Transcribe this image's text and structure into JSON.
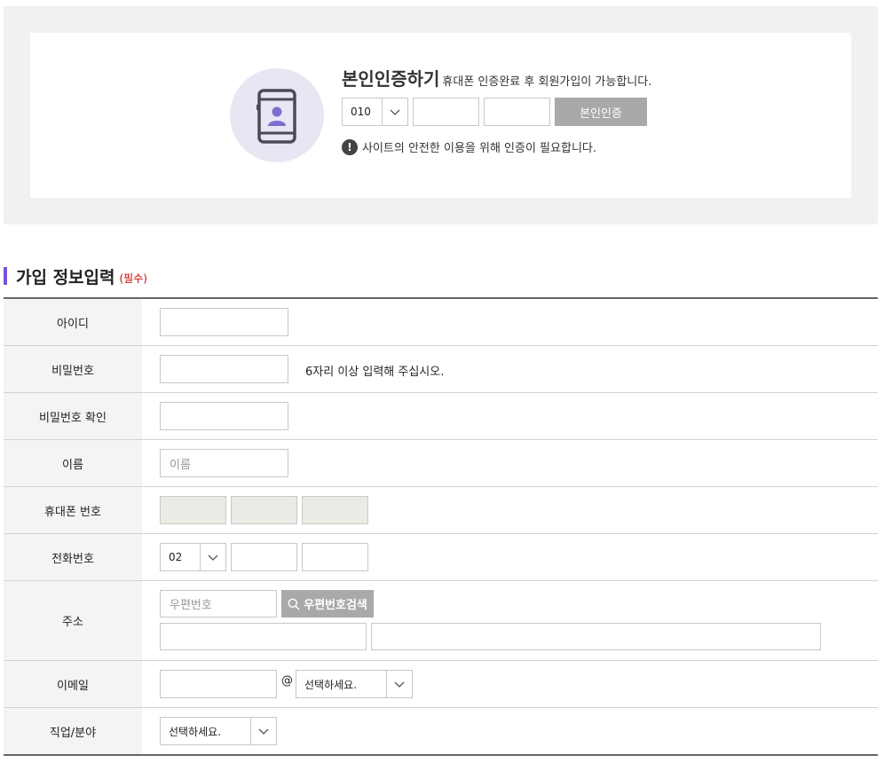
{
  "verify": {
    "title": "본인인증하기",
    "description": "휴대폰 인증완료 후 회원가입이 가능합니다.",
    "phone_prefix": "010",
    "button_label": "본인인증",
    "note": "사이트의 안전한 이용을 위해 인증이 필요합니다.",
    "note_icon": "!"
  },
  "section": {
    "title": "가입 정보입력",
    "required_tag": "(필수)"
  },
  "form": {
    "id_label": "아이디",
    "password_label": "비밀번호",
    "password_hint": "6자리 이상 입력해 주십시오.",
    "password_confirm_label": "비밀번호 확인",
    "name_label": "이름",
    "name_placeholder": "이름",
    "mobile_label": "휴대폰 번호",
    "phone_label": "전화번호",
    "phone_prefix": "02",
    "address_label": "주소",
    "zipcode_placeholder": "우편번호",
    "zipcode_button": "우편번호검색",
    "email_label": "이메일",
    "email_at": "@",
    "email_domain_select": "선택하세요.",
    "job_label": "직업/분야",
    "job_select": "선택하세요."
  },
  "colors": {
    "accent": "#7b52d9",
    "required": "#d10000",
    "button_gray": "#a9a9a9",
    "icon_circle": "#e9e6f3"
  },
  "icons": {
    "verify": "mobile-person-icon",
    "search": "search-icon",
    "dropdown": "chevron-down-icon"
  }
}
